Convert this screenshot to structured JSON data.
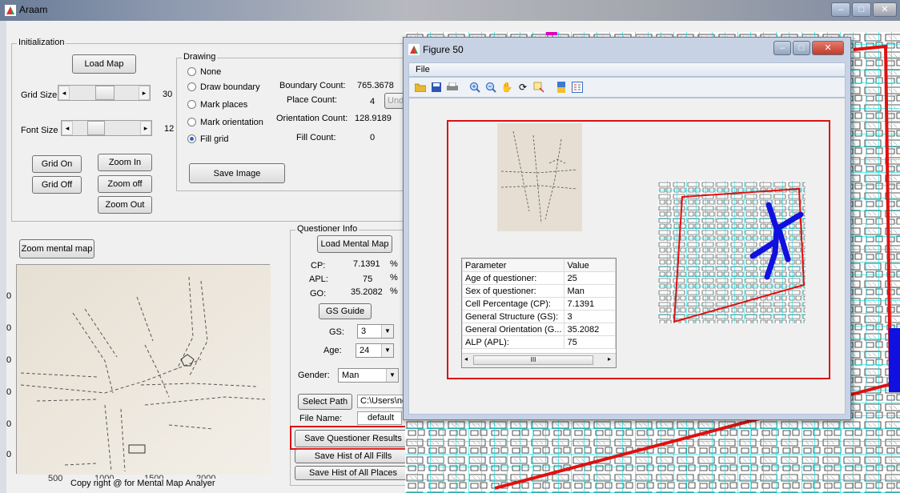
{
  "window": {
    "title": "Araam"
  },
  "initialization": {
    "title": "Initialization",
    "load_map": "Load Map",
    "grid_size_label": "Grid Size",
    "grid_size_value": "30",
    "font_size_label": "Font Size",
    "font_size_value": "12",
    "grid_on": "Grid On",
    "grid_off": "Grid Off",
    "zoom_in": "Zoom In",
    "zoom_off": "Zoom off",
    "zoom_out": "Zoom Out"
  },
  "drawing": {
    "title": "Drawing",
    "options": [
      "None",
      "Draw boundary",
      "Mark places",
      "Mark orientation",
      "Fill grid"
    ],
    "selected_index": 4,
    "stats": [
      {
        "label": "Boundary Count:",
        "value": "765.3678"
      },
      {
        "label": "Place Count:",
        "value": "4"
      },
      {
        "label": "Orientation Count:",
        "value": "128.9189"
      },
      {
        "label": "Fill Count:",
        "value": "0"
      }
    ],
    "undo_partial": "Und",
    "save_image": "Save Image"
  },
  "mental_map": {
    "zoom_button": "Zoom mental map",
    "x_ticks": [
      "500",
      "1000",
      "1500",
      "2000"
    ],
    "y_tick": "0"
  },
  "questioner": {
    "title": "Questioner Info",
    "load_button": "Load Mental Map",
    "metrics": [
      {
        "label": "CP:",
        "value": "7.1391",
        "unit": "%"
      },
      {
        "label": "APL:",
        "value": "75",
        "unit": "%"
      },
      {
        "label": "GO:",
        "value": "35.2082",
        "unit": "%"
      }
    ],
    "gs_guide": "GS Guide",
    "gs_label": "GS:",
    "gs_value": "3",
    "age_label": "Age:",
    "age_value": "24",
    "gender_label": "Gender:",
    "gender_value": "Man",
    "select_path": "Select Path",
    "path_value": "C:\\Users\\no",
    "file_name_label": "File Name:",
    "file_name_value": "default",
    "save_results": "Save Questioner Results",
    "save_hist_fills": "Save Hist of All Fills",
    "save_hist_places": "Save Hist of All Places"
  },
  "footer": {
    "copyright": "Copy right @ for Mental Map Analyer"
  },
  "figure": {
    "title": "Figure 50",
    "menu": [
      "File"
    ],
    "table": {
      "headers": [
        "Parameter",
        "Value"
      ],
      "rows": [
        [
          "Age of questioner:",
          "25"
        ],
        [
          "Sex of questioner:",
          "Man"
        ],
        [
          "Cell Percentage (CP):",
          "7.1391"
        ],
        [
          "General Structure (GS):",
          "3"
        ],
        [
          "General Orientation (G...",
          "35.2082"
        ],
        [
          "ALP (APL):",
          "75"
        ]
      ],
      "scroll_grip": "III"
    }
  },
  "colors": {
    "highlight_red": "#d11111",
    "grid_cyan": "#00e0e0",
    "route_blue": "#1010e0"
  }
}
